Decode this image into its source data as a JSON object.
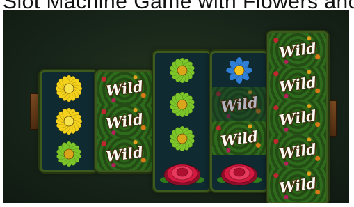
{
  "header": {
    "clipped_text": "Slot Machine Game with Flowers and Wild Symbols"
  },
  "colors": {
    "background": "#18251a",
    "reel_bg": "#0f2a30",
    "vine_green": "#2f6b1c",
    "wild_text": "#fbfbf4",
    "yellow_flower": "#f4d11a",
    "green_flower": "#7cc62a",
    "blue_flower": "#2f7fd6",
    "red_rose": "#d3193f"
  },
  "symbols": {
    "wild_label": "Wild"
  },
  "reels": [
    {
      "rows": [
        "yellow-flower",
        "yellow-flower",
        "green-flower"
      ]
    },
    {
      "rows": [
        "wild",
        "wild",
        "wild"
      ]
    },
    {
      "rows": [
        "green-flower",
        "green-flower",
        "green-flower",
        "red-rose"
      ]
    },
    {
      "rows": [
        "blue-flower",
        "wild-faded",
        "wild",
        "red-rose"
      ]
    },
    {
      "rows": [
        "wild",
        "wild",
        "wild",
        "wild",
        "wild"
      ]
    }
  ]
}
